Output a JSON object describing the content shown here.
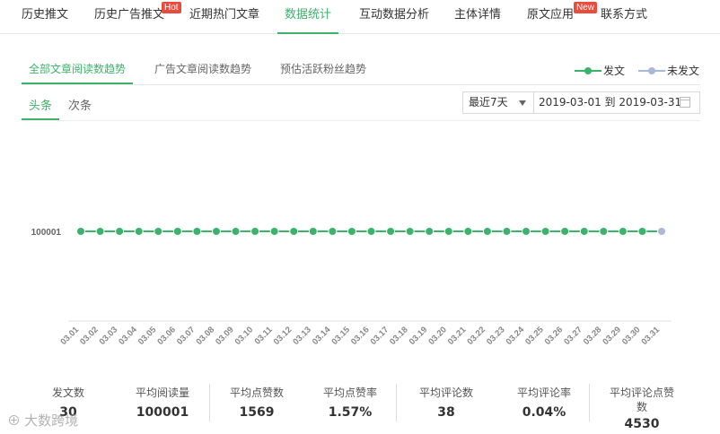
{
  "nav": {
    "tabs": [
      {
        "label": "历史推文"
      },
      {
        "label": "历史广告推文",
        "badge": "Hot"
      },
      {
        "label": "近期热门文章"
      },
      {
        "label": "数据统计",
        "active": true
      },
      {
        "label": "互动数据分析"
      },
      {
        "label": "主体详情"
      },
      {
        "label": "原文应用",
        "badge": "New"
      },
      {
        "label": "联系方式"
      }
    ]
  },
  "subtabs": [
    "全部文章阅读数趋势",
    "广告文章阅读数趋势",
    "预估活跃粉丝趋势"
  ],
  "legend": {
    "posted": "发文",
    "not_posted": "未发文",
    "posted_color": "#3bb36a",
    "not_posted_color": "#a9b8d6"
  },
  "type_tabs": [
    "头条",
    "次条"
  ],
  "date_range": {
    "preset": "最近7天",
    "text": "2019-03-01 到 2019-03-31"
  },
  "chart_data": {
    "type": "line",
    "x": [
      "03.01",
      "03.02",
      "03.03",
      "03.04",
      "03.05",
      "03.06",
      "03.07",
      "03.08",
      "03.09",
      "03.10",
      "03.11",
      "03.12",
      "03.13",
      "03.14",
      "03.15",
      "03.16",
      "03.17",
      "03.18",
      "03.19",
      "03.20",
      "03.21",
      "03.22",
      "03.23",
      "03.24",
      "03.25",
      "03.26",
      "03.27",
      "03.28",
      "03.29",
      "03.30",
      "03.31"
    ],
    "y_tick_labels": [
      "100001"
    ],
    "series": [
      {
        "name": "发文",
        "values": [
          100001,
          100001,
          100001,
          100001,
          100001,
          100001,
          100001,
          100001,
          100001,
          100001,
          100001,
          100001,
          100001,
          100001,
          100001,
          100001,
          100001,
          100001,
          100001,
          100001,
          100001,
          100001,
          100001,
          100001,
          100001,
          100001,
          100001,
          100001,
          100001,
          100001,
          null
        ]
      },
      {
        "name": "未发文",
        "values": [
          null,
          null,
          null,
          null,
          null,
          null,
          null,
          null,
          null,
          null,
          null,
          null,
          null,
          null,
          null,
          null,
          null,
          null,
          null,
          null,
          null,
          null,
          null,
          null,
          null,
          null,
          null,
          null,
          null,
          null,
          100001
        ]
      }
    ],
    "ylim": [
      100000,
      100002
    ],
    "grid": false,
    "legend_position": "top-right"
  },
  "stats": [
    {
      "label": "发文数",
      "value": "30"
    },
    {
      "label": "平均阅读量",
      "value": "100001"
    },
    {
      "label": "平均点赞数",
      "value": "1569"
    },
    {
      "label": "平均点赞率",
      "value": "1.57%"
    },
    {
      "label": "平均评论数",
      "value": "38"
    },
    {
      "label": "平均评论率",
      "value": "0.04%"
    },
    {
      "label": "平均评论点赞",
      "label2": "数",
      "value": "4530"
    }
  ],
  "watermark": "大数跨境"
}
